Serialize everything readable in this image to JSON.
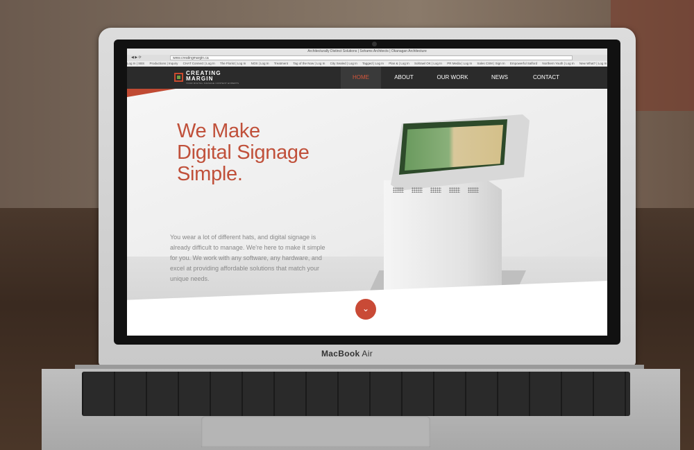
{
  "browser": {
    "window_title": "Architecturally Distinct Solutions | Sohams Architects | Okanagan Architecture",
    "url": "www.creatingmargin.ca",
    "bookmarks": [
      "Log In | SBS",
      "Productions | Inquiry",
      "CHAT Connect | Log In",
      "The Florist | Log In",
      "NOS | Log In",
      "Treatment",
      "Tag of the Now | Log In",
      "City Sealed | Log In",
      "Tagged | Log In",
      "Plan & | Log In",
      "Soltrawl OK | Log In",
      "PR Media | Log In",
      "Sales CSM | Sign In",
      "Empowerful Salford",
      "Northern Youth | Log In",
      "New What? | Log In"
    ]
  },
  "site": {
    "logo": {
      "line1": "CREATING",
      "line2": "MARGIN",
      "tagline": "YOUR DIGITAL SIGNAGE CONTENT EXPERTS"
    },
    "nav": [
      {
        "label": "HOME",
        "active": true
      },
      {
        "label": "ABOUT",
        "active": false
      },
      {
        "label": "OUR WORK",
        "active": false
      },
      {
        "label": "NEWS",
        "active": false
      },
      {
        "label": "CONTACT",
        "active": false
      }
    ],
    "hero": {
      "headline": [
        "We Make",
        "Digital Signage",
        "Simple."
      ],
      "body": "You wear a lot of different hats, and digital signage is already difficult to manage. We're here to make it simple for you. We work with any software, any hardware, and excel at providing affordable solutions that match your unique needs.",
      "scroll_icon": "chevron-down-icon"
    },
    "colors": {
      "accent": "#c94a36",
      "nav_bg": "#2b2b2b",
      "logo_green": "#6fa043"
    }
  },
  "device": {
    "brand_name": "MacBook",
    "brand_model": "Air"
  }
}
